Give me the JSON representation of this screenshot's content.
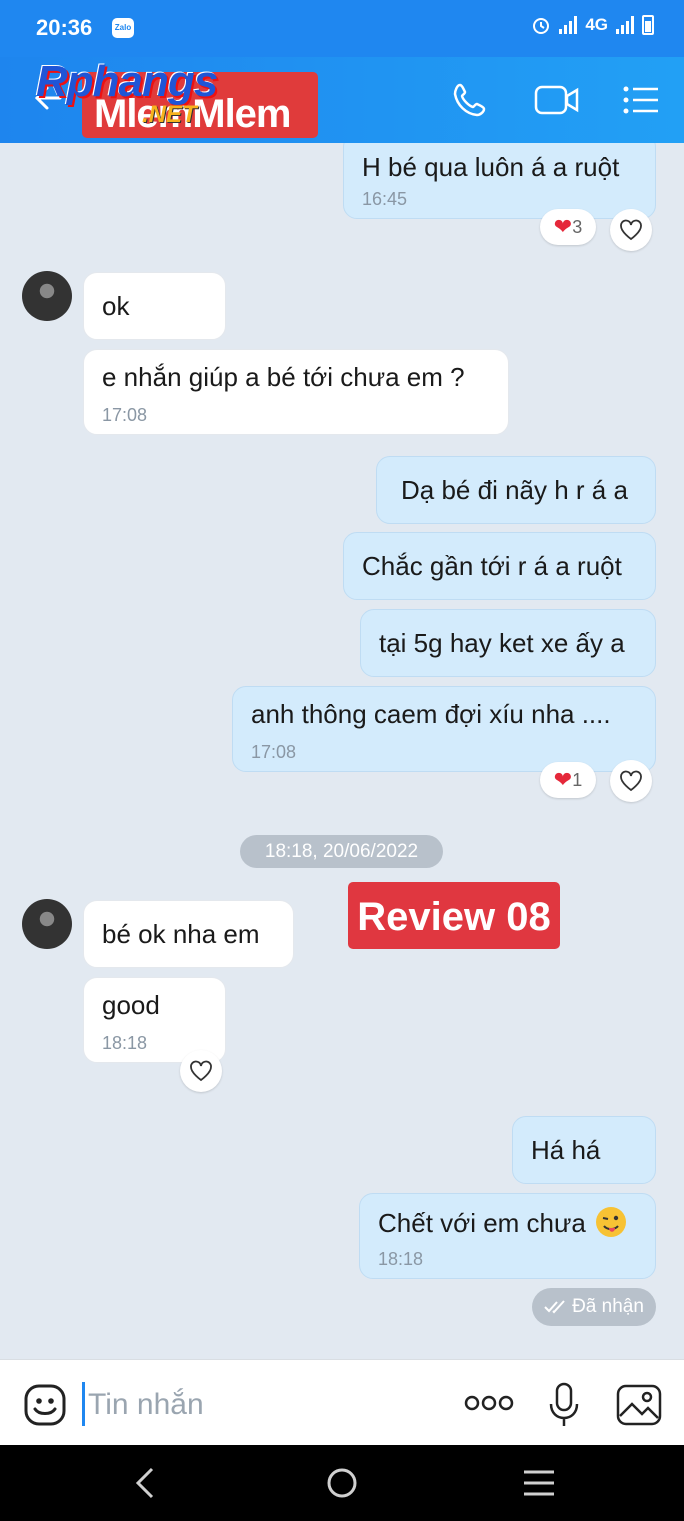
{
  "status_bar": {
    "time": "20:36",
    "app_badge": "Zalo",
    "network": "4G"
  },
  "header": {
    "logo_top": "Rphangs",
    "logo_main": "MlemMlem",
    "logo_net": ".NET"
  },
  "messages": {
    "m1": {
      "text": "H bé qua luôn á a ruột",
      "time": "16:45",
      "reaction_count": "3"
    },
    "m2": {
      "text": "ok"
    },
    "m3": {
      "text": "e nhắn giúp a bé tới chưa em ?",
      "time": "17:08"
    },
    "m4": {
      "text": "Dạ bé đi nãy h r á a"
    },
    "m5": {
      "text": "Chắc gần tới r á a ruột"
    },
    "m6": {
      "text": "tại 5g hay ket xe ấy a"
    },
    "m7": {
      "text": "anh thông caem đợi xíu nha ....",
      "time": "17:08",
      "reaction_count": "1"
    },
    "date_divider": "18:18, 20/06/2022",
    "review_label": "Review 08",
    "m8": {
      "text": "bé ok nha em"
    },
    "m9": {
      "text": "good",
      "time": "18:18"
    },
    "m10": {
      "text": "Há há"
    },
    "m11": {
      "text": "Chết với em chưa",
      "time": "18:18"
    },
    "received_label": "Đã nhận"
  },
  "composer": {
    "placeholder": "Tin nhắn"
  }
}
